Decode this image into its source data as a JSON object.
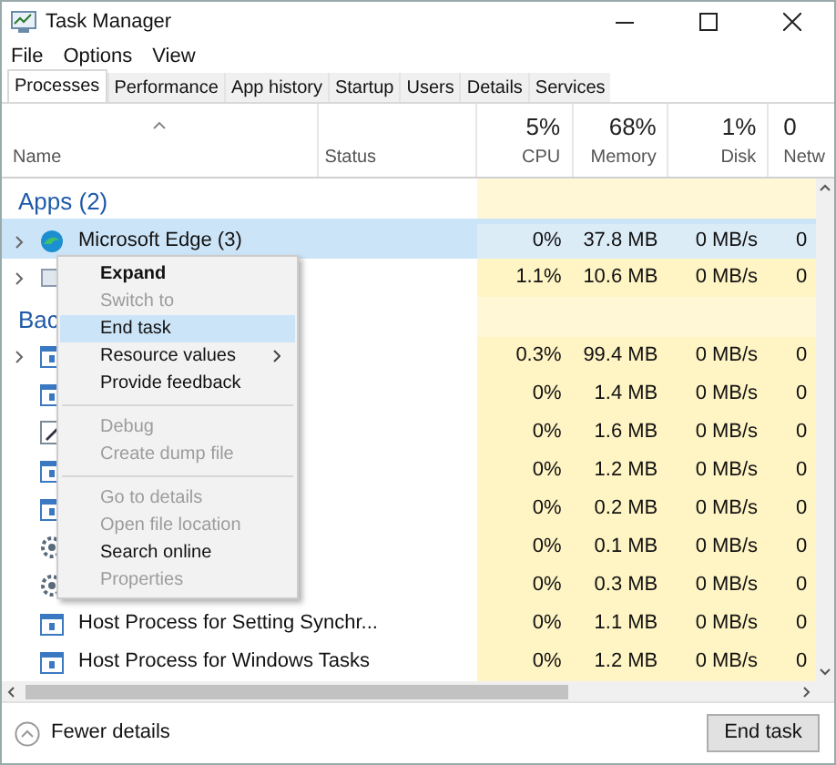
{
  "window": {
    "title": "Task Manager"
  },
  "menu": [
    "File",
    "Options",
    "View"
  ],
  "tabs": [
    {
      "label": "Processes",
      "selected": true
    },
    {
      "label": "Performance",
      "selected": false
    },
    {
      "label": "App history",
      "selected": false
    },
    {
      "label": "Startup",
      "selected": false
    },
    {
      "label": "Users",
      "selected": false
    },
    {
      "label": "Details",
      "selected": false
    },
    {
      "label": "Services",
      "selected": false
    }
  ],
  "columns": {
    "name": "Name",
    "status": "Status",
    "cpu_percent": "5%",
    "cpu": "CPU",
    "memory_percent": "68%",
    "memory": "Memory",
    "disk_percent": "1%",
    "disk": "Disk",
    "network_percent": "0",
    "network": "Netw"
  },
  "rows": [
    {
      "kind": "group",
      "label": "Apps (2)"
    },
    {
      "kind": "process",
      "expandable": true,
      "selected": true,
      "name": "Microsoft Edge (3)",
      "cpu": "0%",
      "memory": "37.8 MB",
      "disk": "0 MB/s",
      "network": "0"
    },
    {
      "kind": "process",
      "expandable": true,
      "selected": false,
      "cpu": "1.1%",
      "memory": "10.6 MB",
      "disk": "0 MB/s",
      "network": "0"
    },
    {
      "kind": "group",
      "label": "Bac"
    },
    {
      "kind": "process",
      "expandable": true,
      "selected": false,
      "cpu": "0.3%",
      "memory": "99.4 MB",
      "disk": "0 MB/s",
      "network": "0"
    },
    {
      "kind": "process",
      "expandable": false,
      "selected": false,
      "cpu": "0%",
      "memory": "1.4 MB",
      "disk": "0 MB/s",
      "network": "0"
    },
    {
      "kind": "process",
      "expandable": false,
      "selected": false,
      "cpu": "0%",
      "memory": "1.6 MB",
      "disk": "0 MB/s",
      "network": "0"
    },
    {
      "kind": "process",
      "expandable": false,
      "selected": false,
      "cpu": "0%",
      "memory": "1.2 MB",
      "disk": "0 MB/s",
      "network": "0"
    },
    {
      "kind": "process",
      "expandable": false,
      "selected": false,
      "cpu": "0%",
      "memory": "0.2 MB",
      "disk": "0 MB/s",
      "network": "0"
    },
    {
      "kind": "process",
      "expandable": false,
      "selected": false,
      "cpu": "0%",
      "memory": "0.1 MB",
      "disk": "0 MB/s",
      "network": "0"
    },
    {
      "kind": "process",
      "expandable": false,
      "selected": false,
      "cpu": "0%",
      "memory": "0.3 MB",
      "disk": "0 MB/s",
      "network": "0"
    },
    {
      "kind": "process",
      "expandable": false,
      "selected": false,
      "name": "Host Process for Setting Synchr...",
      "cpu": "0%",
      "memory": "1.1 MB",
      "disk": "0 MB/s",
      "network": "0"
    },
    {
      "kind": "process",
      "expandable": false,
      "selected": false,
      "name": "Host Process for Windows Tasks",
      "cpu": "0%",
      "memory": "1.2 MB",
      "disk": "0 MB/s",
      "network": "0"
    }
  ],
  "context_menu": [
    {
      "kind": "item",
      "label": "Expand",
      "bold": true,
      "disabled": false,
      "selected": false,
      "submenu": false
    },
    {
      "kind": "item",
      "label": "Switch to",
      "bold": false,
      "disabled": true,
      "selected": false,
      "submenu": false
    },
    {
      "kind": "item",
      "label": "End task",
      "bold": false,
      "disabled": false,
      "selected": true,
      "submenu": false
    },
    {
      "kind": "item",
      "label": "Resource values",
      "bold": false,
      "disabled": false,
      "selected": false,
      "submenu": true
    },
    {
      "kind": "item",
      "label": "Provide feedback",
      "bold": false,
      "disabled": false,
      "selected": false,
      "submenu": false
    },
    {
      "kind": "separator"
    },
    {
      "kind": "item",
      "label": "Debug",
      "bold": false,
      "disabled": true,
      "selected": false,
      "submenu": false
    },
    {
      "kind": "item",
      "label": "Create dump file",
      "bold": false,
      "disabled": true,
      "selected": false,
      "submenu": false
    },
    {
      "kind": "separator"
    },
    {
      "kind": "item",
      "label": "Go to details",
      "bold": false,
      "disabled": true,
      "selected": false,
      "submenu": false
    },
    {
      "kind": "item",
      "label": "Open file location",
      "bold": false,
      "disabled": true,
      "selected": false,
      "submenu": false
    },
    {
      "kind": "item",
      "label": "Search online",
      "bold": false,
      "disabled": false,
      "selected": false,
      "submenu": false
    },
    {
      "kind": "item",
      "label": "Properties",
      "bold": false,
      "disabled": true,
      "selected": false,
      "submenu": false
    }
  ],
  "footer": {
    "toggle": "Fewer details",
    "button": "End task"
  }
}
